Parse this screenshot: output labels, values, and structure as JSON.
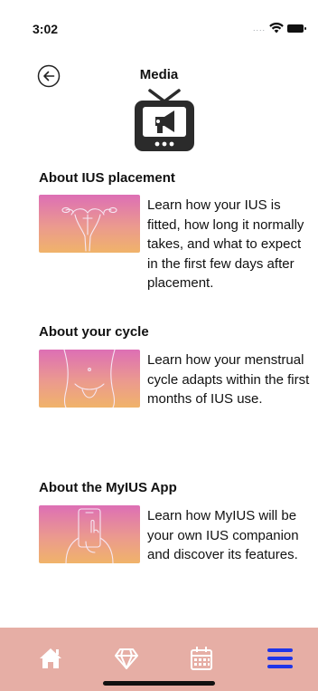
{
  "status_bar": {
    "time": "3:02",
    "signal_icon": "cellular-dots-icon",
    "wifi_icon": "wifi-icon",
    "battery_icon": "battery-icon"
  },
  "header": {
    "back_icon": "back-arrow-circle-icon",
    "title": "Media",
    "hero_icon": "tv-megaphone-icon"
  },
  "sections": [
    {
      "title": "About IUS placement",
      "thumbnail_icon": "uterus-illustration",
      "description": "Learn how your IUS is fitted, how long it normally takes, and what to expect in the first few days after placement."
    },
    {
      "title": "About your cycle",
      "thumbnail_icon": "body-illustration",
      "description": "Learn how your menstrual cycle adapts within the first months of IUS use."
    },
    {
      "title": "About the MyIUS App",
      "thumbnail_icon": "phone-in-hands-illustration",
      "description": "Learn how MyIUS will be your own IUS companion and discover its features."
    }
  ],
  "bottom_nav": {
    "items": [
      "home-icon",
      "diamond-icon",
      "calendar-icon",
      "menu-icon"
    ],
    "active": "menu-icon"
  },
  "colors": {
    "nav_background": "#e6aea5",
    "active_nav": "#1f35e8",
    "inactive_nav": "#ffffff",
    "thumb_gradient": [
      "#dd6fb5",
      "#eb9a8e",
      "#f0b36a"
    ]
  }
}
